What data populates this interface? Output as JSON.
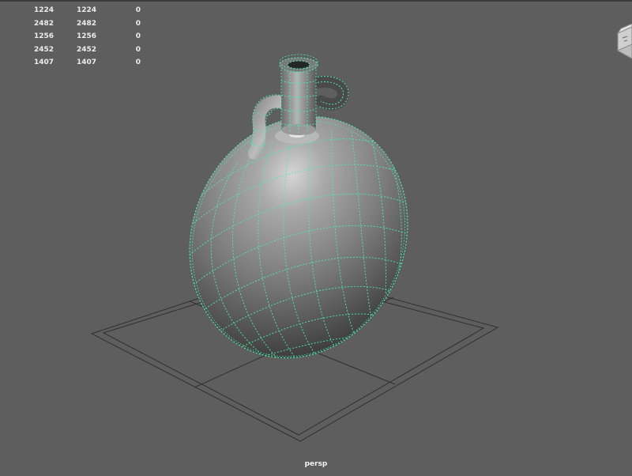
{
  "viewport": {
    "camera_name": "persp",
    "background_color": "#5e5e5e",
    "wireframe_color": "#4fe8b0",
    "grid_color": "#2f2f2f"
  },
  "hud": {
    "rows": [
      [
        "1224",
        "1224",
        "0"
      ],
      [
        "2482",
        "2482",
        "0"
      ],
      [
        "1256",
        "1256",
        "0"
      ],
      [
        "2452",
        "2452",
        "0"
      ],
      [
        "1407",
        "1407",
        "0"
      ]
    ]
  },
  "view_cube": {
    "icon": "view-cube-icon"
  }
}
